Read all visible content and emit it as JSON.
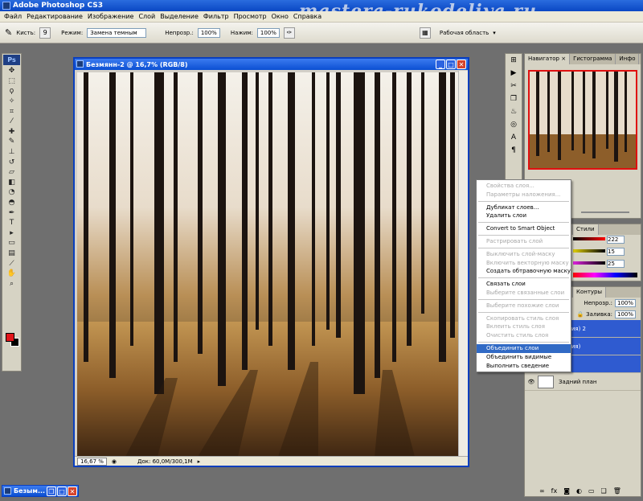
{
  "app": {
    "title": "Adobe Photoshop CS3",
    "watermark": "mastera-rukodeliya.ru"
  },
  "menu": [
    "Файл",
    "Редактирование",
    "Изображение",
    "Слой",
    "Выделение",
    "Фильтр",
    "Просмотр",
    "Окно",
    "Справка"
  ],
  "options": {
    "brush_label": "Кисть:",
    "brush_size": "9",
    "mode_label": "Режим:",
    "mode_value": "Замена темным",
    "opacity_label": "Непрозр.:",
    "opacity_value": "100%",
    "flow_label": "Нажим:",
    "flow_value": "100%",
    "workspace_label": "Рабочая область"
  },
  "document": {
    "title": "Безмянн-2 @ 16,7% (RGB/8)",
    "zoom": "16,67 %",
    "doc_info": "Док: 60,0M/300,1M"
  },
  "panels": {
    "navigator_tabs": [
      "Навигатор ×",
      "Гистограмма",
      "Инфо"
    ],
    "color_tabs": [
      "Стили"
    ],
    "color_values": [
      "222",
      "15",
      "25"
    ],
    "layers_tabs": [
      "Контуры"
    ],
    "opacity_label": "Непрозр.:",
    "opacity_value": "100%",
    "fill_label": "Заливка:",
    "fill_value": "100%",
    "layers": [
      {
        "name": "(копия) 2",
        "selected": true
      },
      {
        "name": "(копия)",
        "selected": true
      },
      {
        "name": "",
        "selected": true
      },
      {
        "name": "Задний план",
        "selected": false
      }
    ]
  },
  "context_menu": [
    {
      "label": "Свойства слоя...",
      "disabled": true
    },
    {
      "label": "Параметры наложения...",
      "disabled": true
    },
    {
      "sep": true
    },
    {
      "label": "Дубликат слоев...",
      "disabled": false
    },
    {
      "label": "Удалить слои",
      "disabled": false
    },
    {
      "sep": true
    },
    {
      "label": "Convert to Smart Object",
      "disabled": false
    },
    {
      "sep": true
    },
    {
      "label": "Растрировать слой",
      "disabled": true
    },
    {
      "sep": true
    },
    {
      "label": "Выключить слой-маску",
      "disabled": true
    },
    {
      "label": "Включить векторную маску",
      "disabled": true
    },
    {
      "label": "Создать обтравочную маску",
      "disabled": false
    },
    {
      "sep": true
    },
    {
      "label": "Связать слои",
      "disabled": false
    },
    {
      "label": "Выберите связанные слои",
      "disabled": true
    },
    {
      "sep": true
    },
    {
      "label": "Выберите похожие слои",
      "disabled": true
    },
    {
      "sep": true
    },
    {
      "label": "Скопировать стиль слоя",
      "disabled": true
    },
    {
      "label": "Вклеить стиль слоя",
      "disabled": true
    },
    {
      "label": "Очистить стиль слоя",
      "disabled": true
    },
    {
      "sep": true
    },
    {
      "label": "Объединить слои",
      "disabled": false,
      "highlight": true
    },
    {
      "label": "Объединить видимые",
      "disabled": false
    },
    {
      "label": "Выполнить сведение",
      "disabled": false
    }
  ],
  "minimized_doc": {
    "title": "Безым..."
  },
  "colors": {
    "foreground": "#e2151b",
    "background": "#000000",
    "selection": "#316ac5"
  }
}
